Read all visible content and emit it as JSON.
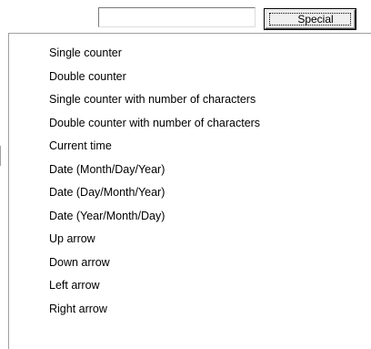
{
  "toolbar": {
    "input_value": "",
    "special_button_label": "Special"
  },
  "menu": {
    "items": [
      {
        "label": "Single counter"
      },
      {
        "label": "Double counter"
      },
      {
        "label": "Single counter with number of characters"
      },
      {
        "label": "Double counter with number of characters"
      },
      {
        "label": "Current time"
      },
      {
        "label": "Date (Month/Day/Year)"
      },
      {
        "label": "Date (Day/Month/Year)"
      },
      {
        "label": "Date (Year/Month/Day)"
      },
      {
        "label": "Up arrow"
      },
      {
        "label": "Down arrow"
      },
      {
        "label": "Left arrow"
      },
      {
        "label": "Right arrow"
      }
    ]
  }
}
